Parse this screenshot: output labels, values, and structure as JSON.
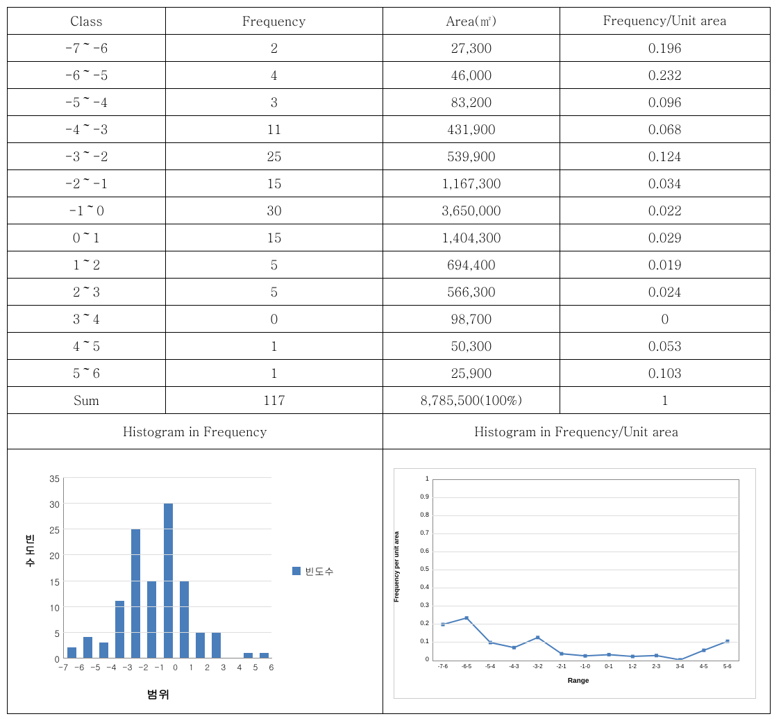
{
  "table": {
    "headers": {
      "class": "Class",
      "frequency": "Frequency",
      "area": "Area(㎡)",
      "freq_per_area": "Frequency/Unit area"
    },
    "rows": [
      {
        "class": "-7～-6",
        "frequency": "2",
        "area": "27,300",
        "fpa": "0.196"
      },
      {
        "class": "-6～-5",
        "frequency": "4",
        "area": "46,000",
        "fpa": "0.232"
      },
      {
        "class": "-5～-4",
        "frequency": "3",
        "area": "83,200",
        "fpa": "0.096"
      },
      {
        "class": "-4～-3",
        "frequency": "11",
        "area": "431,900",
        "fpa": "0.068"
      },
      {
        "class": "-3～-2",
        "frequency": "25",
        "area": "539,900",
        "fpa": "0.124"
      },
      {
        "class": "-2～-1",
        "frequency": "15",
        "area": "1,167,300",
        "fpa": "0.034"
      },
      {
        "class": "-1～0",
        "frequency": "30",
        "area": "3,650,000",
        "fpa": "0.022"
      },
      {
        "class": "0～1",
        "frequency": "15",
        "area": "1,404,300",
        "fpa": "0.029"
      },
      {
        "class": "1～2",
        "frequency": "5",
        "area": "694,400",
        "fpa": "0.019"
      },
      {
        "class": "2～3",
        "frequency": "5",
        "area": "566,300",
        "fpa": "0.024"
      },
      {
        "class": "3～4",
        "frequency": "0",
        "area": "98,700",
        "fpa": "0"
      },
      {
        "class": "4～5",
        "frequency": "1",
        "area": "50,300",
        "fpa": "0.053"
      },
      {
        "class": "5～6",
        "frequency": "1",
        "area": "25,900",
        "fpa": "0.103"
      }
    ],
    "sum": {
      "label": "Sum",
      "frequency": "117",
      "area": "8,785,500(100%)",
      "fpa": "1"
    }
  },
  "subheaders": {
    "left": "Histogram in Frequency",
    "right": "Histogram in Frequency/Unit area"
  },
  "chart_data": [
    {
      "type": "bar",
      "title": "",
      "xlabel": "범위",
      "ylabel": "빈도수",
      "legend": "빈도수",
      "xticks": [
        "-7",
        "-6",
        "-5",
        "-4",
        "-3",
        "-2",
        "-1",
        "0",
        "1",
        "2",
        "3",
        "4",
        "5",
        "6"
      ],
      "yticks": [
        0,
        5,
        10,
        15,
        20,
        25,
        30,
        35
      ],
      "ylim": [
        0,
        35
      ],
      "categories": [
        "-7~-6",
        "-6~-5",
        "-5~-4",
        "-4~-3",
        "-3~-2",
        "-2~-1",
        "-1~0",
        "0~1",
        "1~2",
        "2~3",
        "3~4",
        "4~5",
        "5~6"
      ],
      "values": [
        2,
        4,
        3,
        11,
        25,
        15,
        30,
        15,
        5,
        5,
        0,
        1,
        1
      ]
    },
    {
      "type": "line",
      "title": "",
      "xlabel": "Range",
      "ylabel": "Frequency per unit area",
      "xticks": [
        "-7-6",
        "-6-5",
        "-5-4",
        "-4-3",
        "-3-2",
        "-2-1",
        "-1-0",
        "0-1",
        "1-2",
        "2-3",
        "3-4",
        "4-5",
        "5-6"
      ],
      "yticks": [
        0,
        0.1,
        0.2,
        0.3,
        0.4,
        0.5,
        0.6,
        0.7,
        0.8,
        0.9,
        1
      ],
      "ylim": [
        0,
        1
      ],
      "categories": [
        "-7-6",
        "-6-5",
        "-5-4",
        "-4-3",
        "-3-2",
        "-2-1",
        "-1-0",
        "0-1",
        "1-2",
        "2-3",
        "3-4",
        "4-5",
        "5-6"
      ],
      "values": [
        0.196,
        0.232,
        0.096,
        0.068,
        0.124,
        0.034,
        0.022,
        0.029,
        0.019,
        0.024,
        0,
        0.053,
        0.103
      ]
    }
  ]
}
